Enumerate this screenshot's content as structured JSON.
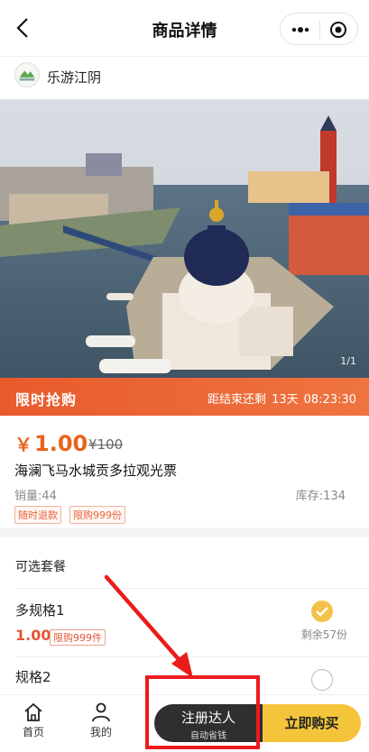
{
  "header": {
    "title": "商品详情",
    "icons": [
      "back-arrow-icon",
      "more-dots-icon",
      "target-icon"
    ]
  },
  "shop": {
    "name": "乐游江阴",
    "logo_text": "乐游江阴"
  },
  "gallery": {
    "pager": "1/1"
  },
  "flash_sale": {
    "label": "限时抢购",
    "countdown_prefix": "距结束还剩",
    "days": "13天",
    "time": "08:23:30",
    "background": "#e85a2c"
  },
  "product": {
    "currency": "￥",
    "price": "1.00",
    "original_price": "¥100",
    "name": "海澜飞马水城贡多拉观光票",
    "sales": "销量:44",
    "stock": "库存:134",
    "tags": [
      "随时退款",
      "限购999份"
    ]
  },
  "packages": {
    "heading": "可选套餐",
    "items": [
      {
        "name": "多规格1",
        "price": "1.00",
        "limit": "限购999件",
        "remaining": "剩余57份",
        "selected": true
      },
      {
        "name": "规格2",
        "selected": false
      }
    ]
  },
  "bottom_bar": {
    "home_label": "首页",
    "mine_label": "我的",
    "register_label": "注册达人",
    "register_sub": "自动省钱",
    "buy_label": "立即购买",
    "accent": "#f4c53a"
  },
  "annotation": {
    "color": "#ec1b1b"
  }
}
